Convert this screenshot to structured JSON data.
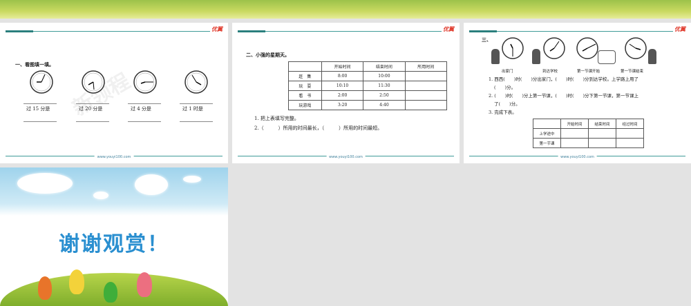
{
  "slides": [
    {
      "title": "一、看图填一填。",
      "labels": [
        "过 15 分是",
        "过 20 分是",
        "过 4 分是",
        "过 1 时是"
      ],
      "watermark": "新领程",
      "footer": "www.youyi100.com",
      "logo": "优翼"
    },
    {
      "title": "二、小强的星期天。",
      "table": {
        "headers": [
          "",
          "开始时间",
          "结束时间",
          "所用时间"
        ],
        "rows": [
          [
            "赶　集",
            "8:00",
            "10:00",
            ""
          ],
          [
            "玩　耍",
            "10:10",
            "11:30",
            ""
          ],
          [
            "看　书",
            "2:00",
            "2:50",
            ""
          ],
          [
            "玩游戏",
            "3:20",
            "4:40",
            ""
          ]
        ]
      },
      "q1": "1. 把上表填写完整。",
      "q2": "2.（　　　）所用的时间最长，（　　　）所用的时间最短。",
      "footer": "www.youyi100.com",
      "logo": "优翼"
    },
    {
      "title": "三、",
      "captions": [
        "出家门",
        "到达学校",
        "第一节课开始",
        "第一节课结束"
      ],
      "q1a": "1. 西西(　　)时(　　)分出家门，(　　)时(　　)分到达学校。上学路上用了",
      "q1b": "(　　)分。",
      "q2a": "2. (　　)时(　　)分上第一节课，(　　)时(　　)分下第一节课，第一节课上",
      "q2b": "了(　　)分。",
      "q3": "3. 完成下表。",
      "table": {
        "headers": [
          "",
          "开始时间",
          "结束时间",
          "经过时间"
        ],
        "rows": [
          [
            "上学途中",
            "",
            "",
            ""
          ],
          [
            "第一节课",
            "",
            "",
            ""
          ]
        ]
      },
      "footer": "www.youyi100.com",
      "logo": "优翼"
    },
    {
      "title": "谢谢观赏！"
    }
  ]
}
